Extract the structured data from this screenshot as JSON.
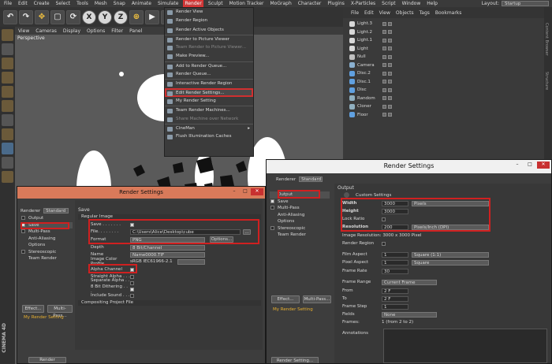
{
  "menubar": {
    "items": [
      "File",
      "Edit",
      "Create",
      "Select",
      "Tools",
      "Mesh",
      "Snap",
      "Animate",
      "Simulate",
      "Render",
      "Sculpt",
      "Motion Tracker",
      "MoGraph",
      "Character",
      "Plugins",
      "X-Particles",
      "Script",
      "Window",
      "Help"
    ],
    "active": "Render",
    "layout_label": "Layout:",
    "layout_value": "Startup"
  },
  "toolbar": {
    "xyz": [
      "X",
      "Y",
      "Z"
    ]
  },
  "viewport": {
    "menu": [
      "View",
      "Cameras",
      "Display",
      "Options",
      "Filter",
      "Panel"
    ],
    "label": "Perspective"
  },
  "render_menu": {
    "items": [
      {
        "label": "Render View",
        "dim": false
      },
      {
        "label": "Render Region",
        "dim": false
      },
      {
        "label": "Render Active Objects",
        "dim": false
      },
      {
        "label": "Render to Picture Viewer",
        "dim": false,
        "sep": true
      },
      {
        "label": "Team Render to Picture Viewer...",
        "dim": true
      },
      {
        "label": "Make Preview...",
        "dim": false
      },
      {
        "label": "Add to Render Queue...",
        "dim": false,
        "sep": true
      },
      {
        "label": "Render Queue...",
        "dim": false
      },
      {
        "label": "Interactive Render Region",
        "dim": false,
        "sep": true
      },
      {
        "label": "Edit Render Settings...",
        "dim": false,
        "sep": true,
        "highlight": true
      },
      {
        "label": "My Render Setting",
        "dim": false
      },
      {
        "label": "Team Render Machines...",
        "dim": false,
        "sep": true
      },
      {
        "label": "Share Machine over Network",
        "dim": true
      },
      {
        "label": "CineMan",
        "dim": false,
        "sep": true,
        "submenu": true
      },
      {
        "label": "Flush Illumination Caches",
        "dim": false
      }
    ]
  },
  "objects_panel": {
    "menu": [
      "File",
      "Edit",
      "View",
      "Objects",
      "Tags",
      "Bookmarks"
    ],
    "items": [
      {
        "name": "Light.3",
        "color": "#d8d8d8"
      },
      {
        "name": "Light.2",
        "color": "#d8d8d8"
      },
      {
        "name": "Light.1",
        "color": "#d8d8d8"
      },
      {
        "name": "Light",
        "color": "#d8d8d8"
      },
      {
        "name": "Null",
        "color": "#c0c0c0"
      },
      {
        "name": "Camera",
        "color": "#8ab0d0"
      },
      {
        "name": "Disc.2",
        "color": "#60a0e0"
      },
      {
        "name": "Disc.1",
        "color": "#60a0e0"
      },
      {
        "name": "Disc",
        "color": "#60a0e0"
      },
      {
        "name": "Random",
        "color": "#90b0c0"
      },
      {
        "name": "Cloner",
        "color": "#90b0c0"
      },
      {
        "name": "Floor",
        "color": "#60a0e0"
      }
    ]
  },
  "right_strip": [
    "Content Browser",
    "Structure",
    "Objects"
  ],
  "win1": {
    "title": "Render Settings",
    "renderer_label": "Renderer",
    "renderer_value": "Standard",
    "sidebar": [
      "Output",
      "Save",
      "Multi-Pass",
      "Anti-Aliasing",
      "Options",
      "Stereoscopic",
      "Team Render"
    ],
    "save_header": "Save",
    "regular_image": "Regular Image",
    "rows": {
      "save_label": "Save . . . . . . .",
      "file_label": "File. . . . . . . .",
      "file_value": "C:\\Users\\Alice\\Desktop\\cube",
      "format_label": "Format",
      "format_value": "PNG",
      "options_btn": "Options...",
      "depth_label": "Depth",
      "depth_value": "8 Bit/Channel",
      "name_label": "Name",
      "name_value": "Name0000.TIF",
      "profile_label": "Image Color Profile",
      "profile_value": "sRGB IEC61966-2.1",
      "alpha_label": "Alpha Channel",
      "straight_label": "Straight Alpha . . .",
      "separate_label": "Separate Alpha . . .",
      "dither_label": "8 Bit Dithering . . .",
      "sound_label": "Include Sound . . ."
    },
    "compositing": "Compositing Project File",
    "effect_btn": "Effect...",
    "multipass_btn": "Multi-Pass...",
    "setting_item": "My Render Setting",
    "bottom_btn": "Render Setting..."
  },
  "win2": {
    "title": "Render Settings",
    "renderer_label": "Renderer",
    "renderer_value": "Standard",
    "sidebar": [
      "Output",
      "Save",
      "Multi-Pass",
      "Anti-Aliasing",
      "Options",
      "Stereoscopic",
      "Team Render"
    ],
    "output_header": "Output",
    "custom_settings": "Custom Settings",
    "width_label": "Width",
    "width_value": "3000",
    "width_unit": "Pixels",
    "height_label": "Height",
    "height_value": "3000",
    "lock_label": "Lock Ratio",
    "res_label": "Resolution",
    "res_value": "200",
    "res_unit": "Pixels/Inch (DPI)",
    "image_res": "Image Resolution: 3000 x 3000 Pixel",
    "render_region": "Render Region",
    "film_aspect_label": "Film Aspect",
    "film_aspect_value": "1",
    "film_aspect_sel": "Square (1:1)",
    "pixel_aspect_label": "Pixel Aspect",
    "pixel_aspect_value": "1",
    "pixel_aspect_sel": "Square",
    "frame_rate_label": "Frame Rate",
    "frame_rate_value": "30",
    "frame_range_label": "Frame Range",
    "frame_range_value": "Current Frame",
    "from_label": "From",
    "from_value": "2 F",
    "to_label": "To",
    "to_value": "2 F",
    "frame_step_label": "Frame Step",
    "frame_step_value": "1",
    "fields_label": "Fields",
    "fields_value": "None",
    "frames_label": "Frames:",
    "frames_value": "1 (from 2 to 2)",
    "annotations_label": "Annotations",
    "effect_btn": "Effect...",
    "multipass_btn": "Multi-Pass...",
    "setting_item": "My Render Setting",
    "bottom_btn": "Render Setting..."
  },
  "cinema_logo": "CINEMA 4D"
}
